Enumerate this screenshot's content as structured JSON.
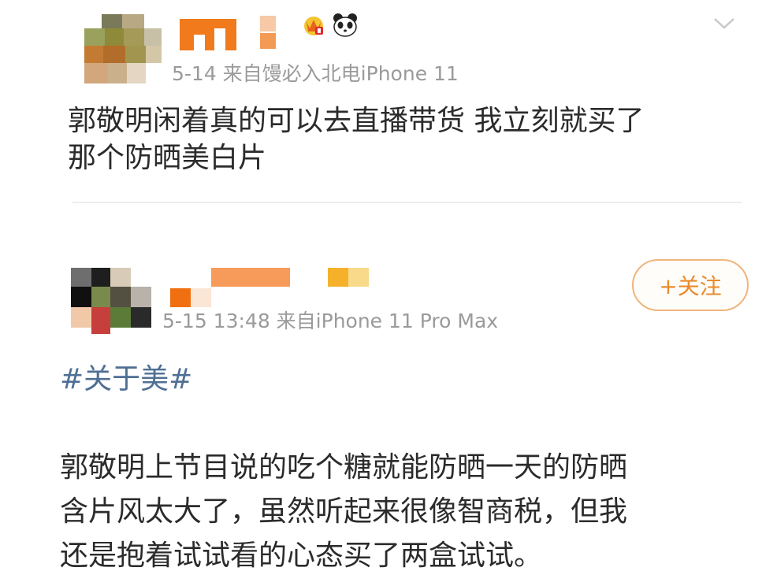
{
  "colors": {
    "meta_text": "#9a9a9a",
    "body_text": "#2b2b2b",
    "hashtag": "#4f6f94",
    "follow_border": "#f0b47c",
    "follow_text": "#e98b2c"
  },
  "post1": {
    "avatar_icon": "avatar-icon",
    "badges": [
      "crown-vip-icon",
      "panda-icon"
    ],
    "menu_icon": "chevron-down-icon",
    "meta": "5-14  来自馒必入北电iPhone 11",
    "body_lines": [
      "郭敬明闲着真的可以去直播带货 我立刻就买了",
      "那个防晒美白片"
    ]
  },
  "post2": {
    "avatar_icon": "avatar-icon",
    "follow_label": "+关注",
    "meta": "5-15 13:48  来自iPhone 11 Pro Max",
    "hashtag": "#关于美#",
    "body_lines": [
      "郭敬明上节目说的吃个糖就能防晒一天的防晒",
      "含片风太大了，虽然听起来很像智商税，但我",
      "还是抱着试试看的心态买了两盒试试。"
    ]
  }
}
